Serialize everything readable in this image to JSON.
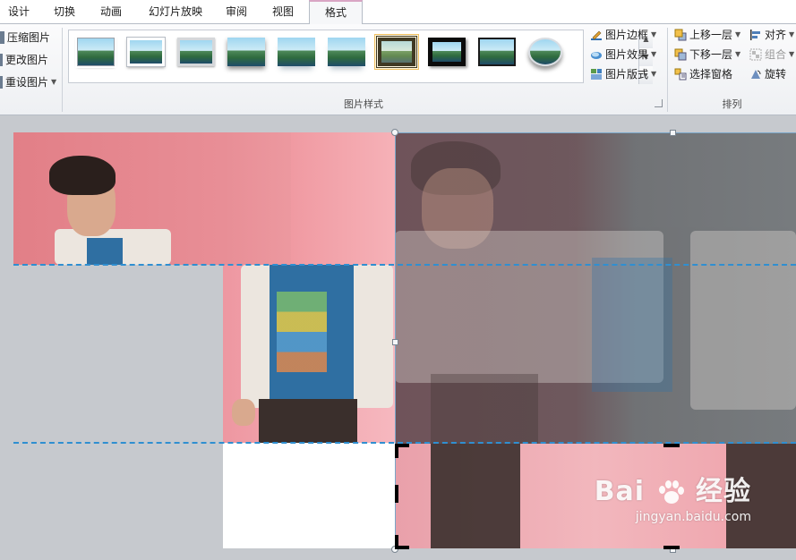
{
  "ribbon": {
    "tabs": [
      {
        "label": "设计",
        "active": false
      },
      {
        "label": "切换",
        "active": false
      },
      {
        "label": "动画",
        "active": false
      },
      {
        "label": "幻灯片放映",
        "active": false
      },
      {
        "label": "审阅",
        "active": false
      },
      {
        "label": "视图",
        "active": false
      },
      {
        "label": "格式",
        "active": true
      }
    ],
    "adjust_group": {
      "compress": "压缩图片",
      "change": "更改图片",
      "reset": "重设图片"
    },
    "picture_styles_group": {
      "label": "图片样式",
      "gallery": [
        "simple-frame-white",
        "soft-edge-rectangle",
        "simple-frame-gray",
        "drop-shadow-rectangle",
        "reflected-rounded",
        "reflected-rectangle",
        "thick-black-frame",
        "black-matte-frame",
        "thin-black-frame",
        "oval-soft-shadow"
      ],
      "selected_index": 6,
      "border": "图片边框",
      "effects": "图片效果",
      "layout": "图片版式"
    },
    "arrange_group": {
      "label": "排列",
      "bring_forward": "上移一层",
      "send_backward": "下移一层",
      "selection_pane": "选择窗格",
      "align": "对齐",
      "group": "组合",
      "rotate": "旋转"
    }
  },
  "watermark": {
    "brand": "Bai",
    "brand_cn": "经验",
    "url": "jingyan.baidu.com"
  },
  "colors": {
    "accent_tab": "#d9a5c4",
    "guide_dash": "#2f8fd1",
    "slide_pink": "#e88e96"
  }
}
